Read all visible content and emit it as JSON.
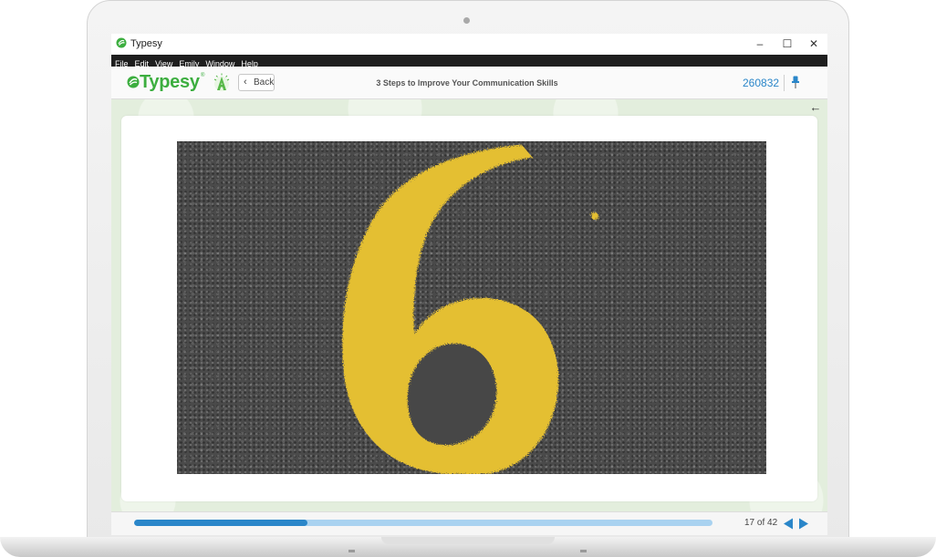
{
  "window": {
    "title": "Typesy",
    "controls": {
      "minimize": "–",
      "maximize": "☐",
      "close": "✕"
    }
  },
  "menu": [
    "File",
    "Edit",
    "View",
    "Emily",
    "Window",
    "Help"
  ],
  "toolbar": {
    "logo_text": "Typesy",
    "logo_reg": "®",
    "back_label": "Back",
    "lesson_title": "3 Steps to Improve Your Communication Skills",
    "points": "260832"
  },
  "icons": {
    "app_logo": "typesy-leaf-icon",
    "achievement": "achievement-badge-icon",
    "back": "chevron-left-icon",
    "pin": "pin-icon",
    "collapse": "arrow-left-icon",
    "prev": "triangle-left-icon",
    "next": "triangle-right-icon"
  },
  "slide": {
    "image_subject": "yellow number six painted on asphalt"
  },
  "footer": {
    "progress_fraction": 0.3,
    "page_count": "17 of 42"
  },
  "colors": {
    "brand_green": "#3cae3f",
    "accent_blue": "#2a86c9",
    "progress_track": "#a9d2f0",
    "paint_yellow": "#e8c233"
  }
}
